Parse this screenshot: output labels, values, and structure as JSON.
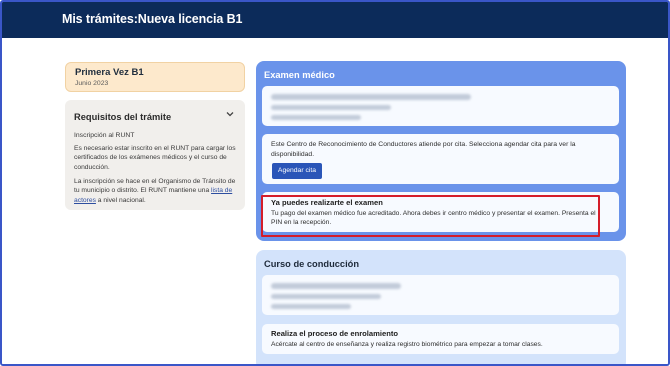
{
  "header": {
    "title": "Mis trámites:Nueva licencia B1"
  },
  "left": {
    "status_card": {
      "title": "Primera Vez B1",
      "date": "Junio 2023"
    },
    "requirements": {
      "title": "Requisitos del trámite",
      "subtitle": "Inscripción al RUNT",
      "paragraph1": "Es necesario estar inscrito en el RUNT para cargar los certificados de los exámenes médicos y el curso de conducción.",
      "paragraph2_before_link": "La inscripción se hace en el Organismo de Tránsito de tu municipio o distrito. El RUNT mantiene una ",
      "paragraph2_link": "lista de actores",
      "paragraph2_after_link": " a nivel nacional.",
      "toggle_icon": "chevron-down-icon"
    }
  },
  "exam": {
    "title": "Examen médico",
    "appointment_text": "Este Centro de Reconocimiento de Conductores atiende por cita. Selecciona agendar cita para ver la disponibilidad.",
    "schedule_button": "Agendar cita",
    "ready_title": "Ya puedes realizarte el examen",
    "ready_text": "Tu pago del examen médico fue acreditado. Ahora debes ir centro médico y presentar el examen. Presenta el PIN en la recepción."
  },
  "course": {
    "title": "Curso de conducción",
    "enroll_title": "Realiza el proceso de enrolamiento",
    "enroll_text": "Acércate al centro de enseñanza y realiza registro biométrico para empezar a tomar clases."
  },
  "colors": {
    "header_bg": "#0c2b5a",
    "exam_panel": "#6a93ea",
    "course_panel": "#d3e3fb",
    "status_card": "#fde9cc",
    "button": "#2a55b8",
    "highlight": "#d41d2a"
  }
}
